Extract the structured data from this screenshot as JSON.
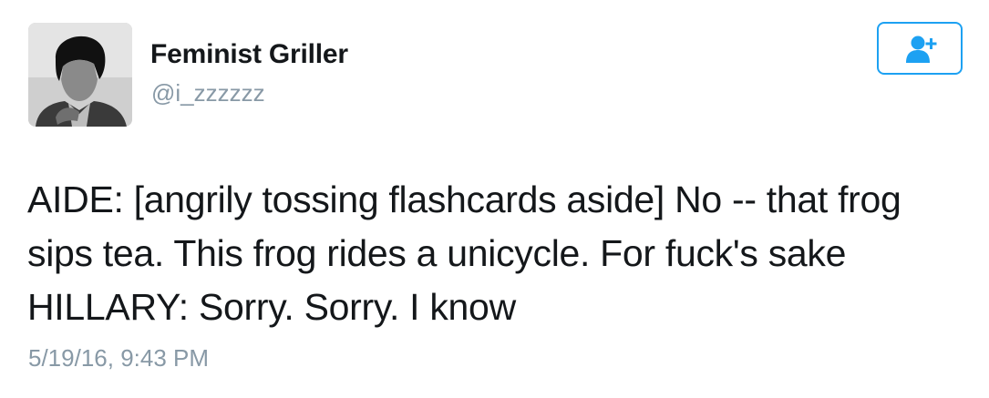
{
  "author": {
    "display_name": "Feminist Griller",
    "handle": "@i_zzzzzz",
    "avatar_icon": "user-avatar-photo"
  },
  "follow_button": {
    "icon": "follow-add-user-icon",
    "color": "#1da1f2"
  },
  "tweet": {
    "lines": [
      "AIDE: [angrily tossing flashcards aside] No -- that frog",
      "sips tea. This frog rides a unicycle. For fuck's sake",
      "HILLARY: Sorry. Sorry. I know"
    ],
    "timestamp": "5/19/16, 9:43 PM"
  },
  "colors": {
    "text": "#14171a",
    "secondary": "#8899a6",
    "accent": "#1da1f2"
  }
}
